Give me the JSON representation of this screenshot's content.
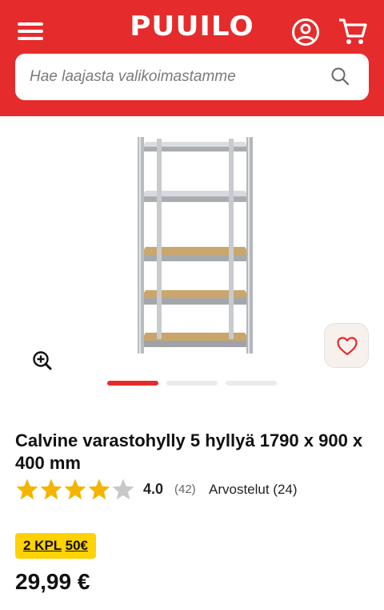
{
  "header": {
    "logo": "PUUILO",
    "background": "#e52b2b",
    "icons": [
      "menu-icon",
      "account-icon",
      "cart-icon"
    ]
  },
  "search": {
    "placeholder": "Hae laajasta valikoimastamme",
    "icon": "search-icon"
  },
  "gallery": {
    "image_alt": "Calvine varastohylly",
    "slides": 3,
    "active_slide": 0,
    "icons": [
      "zoom-icon",
      "heart-icon"
    ]
  },
  "product": {
    "title": "Calvine varastohylly 5 hyllyä 1790 x 900 x 400 mm",
    "rating": {
      "value": "4.0",
      "stars_filled": 4,
      "stars_total": 5,
      "count": "(42)",
      "reviews_label": "Arvostelut (24)"
    },
    "badge": {
      "qty": "2 KPL",
      "price": "50€",
      "color": "#ffd200"
    },
    "price": "29,99 €"
  }
}
